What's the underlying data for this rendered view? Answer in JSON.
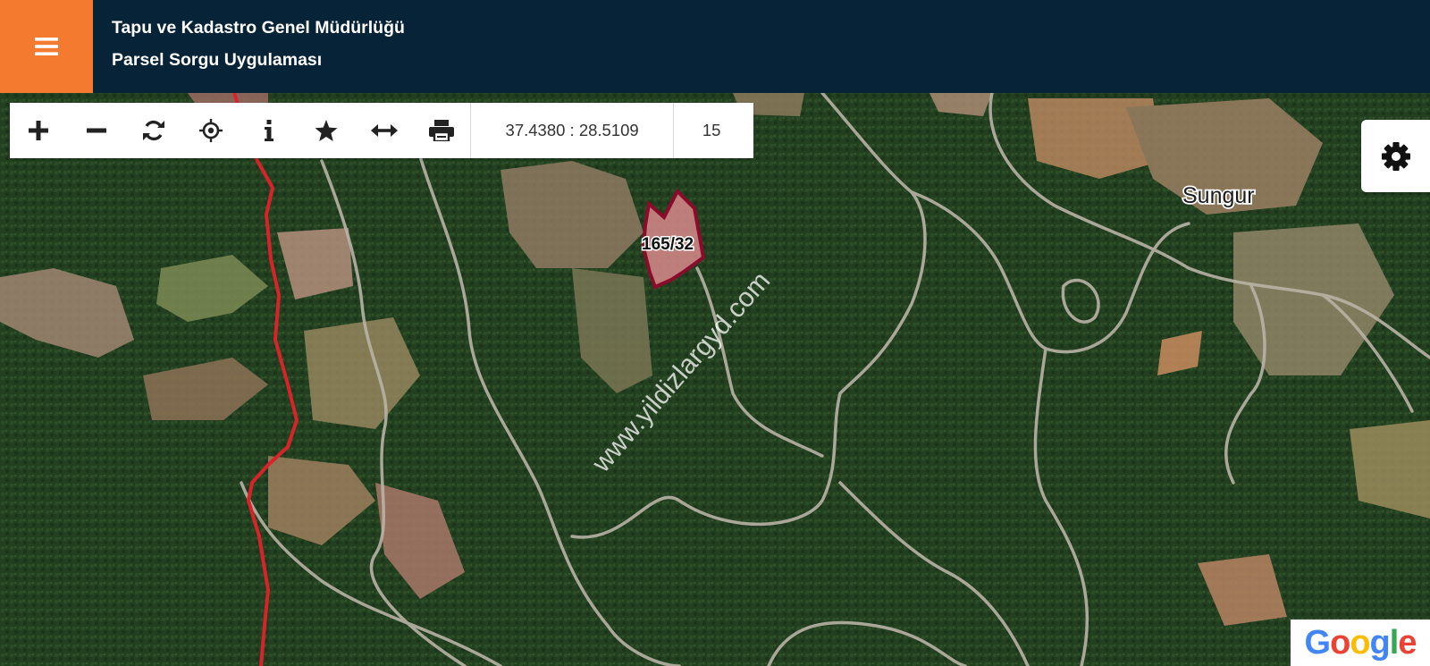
{
  "header": {
    "title_line1": "Tapu ve Kadastro Genel Müdürlüğü",
    "title_line2": "Parsel Sorgu Uygulaması",
    "menu_icon": "hamburger-menu-icon",
    "accent_color": "#f47a30",
    "bar_color": "#062338"
  },
  "toolbar": {
    "buttons": [
      {
        "icon": "zoom-in-icon"
      },
      {
        "icon": "zoom-out-icon"
      },
      {
        "icon": "refresh-icon"
      },
      {
        "icon": "locate-icon"
      },
      {
        "icon": "info-icon"
      },
      {
        "icon": "star-icon"
      },
      {
        "icon": "measure-icon"
      },
      {
        "icon": "print-icon"
      }
    ],
    "coordinates": "37.4380 : 28.5109",
    "zoom_level": "15"
  },
  "map": {
    "parcel_label": "165/32",
    "place_label": "Sungur",
    "watermark": "www.yildizlargyd.com",
    "parcel_color": "#8b0c2a",
    "boundary_color": "#d8232a",
    "attribution": "Google"
  },
  "settings": {
    "icon": "gear-icon"
  }
}
